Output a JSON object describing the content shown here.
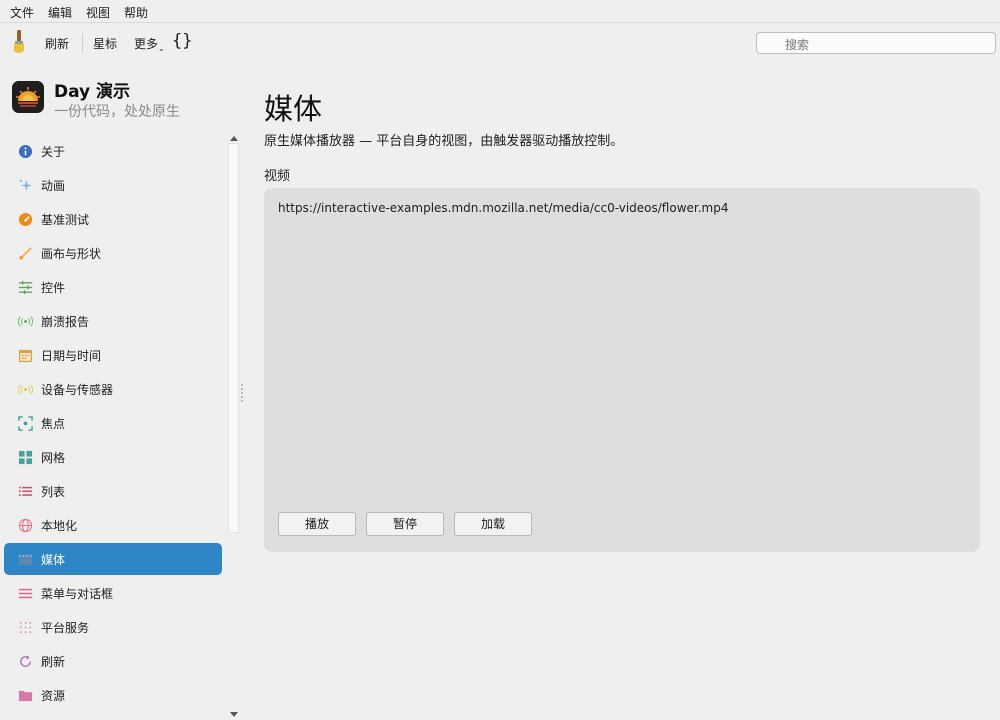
{
  "menu": {
    "file": "文件",
    "edit": "编辑",
    "view": "视图",
    "help": "帮助"
  },
  "toolbar": {
    "refresh": "刷新",
    "star": "星标",
    "more": "更多",
    "braces": "{}"
  },
  "search": {
    "placeholder": "搜索"
  },
  "app": {
    "title": "Day 演示",
    "subtitle": "一份代码，处处原生"
  },
  "sidebar": {
    "items": [
      {
        "label": "关于",
        "icon": "info-icon"
      },
      {
        "label": "动画",
        "icon": "sparkle-icon"
      },
      {
        "label": "基准测试",
        "icon": "gauge-icon"
      },
      {
        "label": "画布与形状",
        "icon": "brush-icon"
      },
      {
        "label": "控件",
        "icon": "sliders-icon"
      },
      {
        "label": "崩溃报告",
        "icon": "broadcast-icon"
      },
      {
        "label": "日期与时间",
        "icon": "calendar-icon"
      },
      {
        "label": "设备与传感器",
        "icon": "sensor-icon"
      },
      {
        "label": "焦点",
        "icon": "focus-icon"
      },
      {
        "label": "网格",
        "icon": "grid-icon"
      },
      {
        "label": "列表",
        "icon": "list-icon"
      },
      {
        "label": "本地化",
        "icon": "globe-icon"
      },
      {
        "label": "媒体",
        "icon": "film-icon",
        "active": true
      },
      {
        "label": "菜单与对话框",
        "icon": "menu-icon"
      },
      {
        "label": "平台服务",
        "icon": "dots-grid-icon"
      },
      {
        "label": "刷新",
        "icon": "refresh-icon"
      },
      {
        "label": "资源",
        "icon": "folder-icon"
      }
    ]
  },
  "main": {
    "title": "媒体",
    "description": "原生媒体播放器 — 平台自身的视图，由触发器驱动播放控制。",
    "section": "视频",
    "video_url": "https://interactive-examples.mdn.mozilla.net/media/cc0-videos/flower.mp4",
    "buttons": {
      "play": "播放",
      "pause": "暂停",
      "load": "加载"
    }
  },
  "colors": {
    "accent": "#2f86c6",
    "panel": "#dedede",
    "background": "#efefef"
  }
}
